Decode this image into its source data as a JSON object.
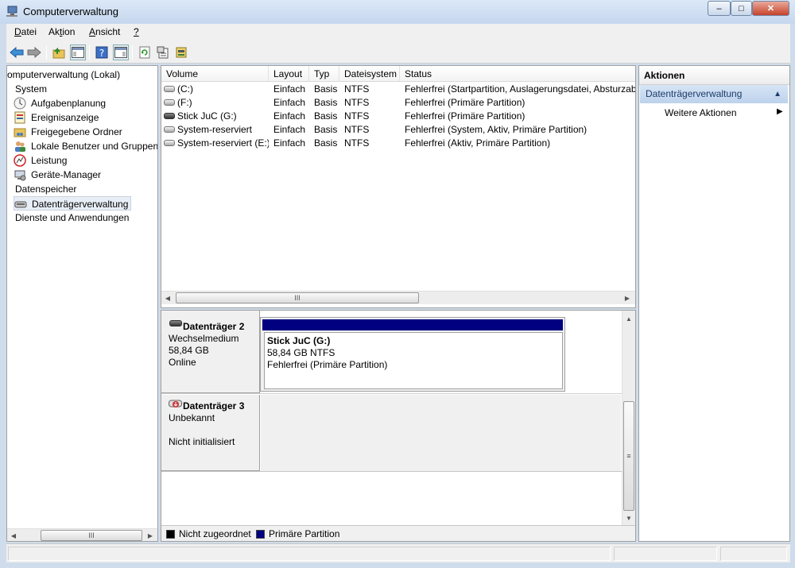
{
  "window": {
    "title": "Computerverwaltung",
    "btn_min": "–",
    "btn_max": "□",
    "btn_close": "✕"
  },
  "menu": {
    "datei": {
      "mnemonic": "D",
      "rest": "atei"
    },
    "aktion": {
      "pre": "Ak",
      "mnemonic": "t",
      "post": "ion"
    },
    "ansicht": {
      "mnemonic": "A",
      "rest": "nsicht"
    },
    "help": "?"
  },
  "tree": {
    "root": "omputerverwaltung (Lokal)",
    "system": "System",
    "items": [
      "Aufgabenplanung",
      "Ereignisanzeige",
      "Freigegebene Ordner",
      "Lokale Benutzer und Gruppen",
      "Leistung",
      "Geräte-Manager"
    ],
    "datenspeicher": "Datenspeicher",
    "selected": "Datenträgerverwaltung",
    "dienste": "Dienste und Anwendungen",
    "scroll_thumb": "III",
    "arrow_left": "◀",
    "arrow_right": "▶"
  },
  "volumes": {
    "headers": [
      "Volume",
      "Layout",
      "Typ",
      "Dateisystem",
      "Status"
    ],
    "rows": [
      {
        "volume": " (C:)",
        "layout": "Einfach",
        "typ": "Basis",
        "fs": "NTFS",
        "status": "Fehlerfrei (Startpartition, Auslagerungsdatei, Absturzab"
      },
      {
        "volume": " (F:)",
        "layout": "Einfach",
        "typ": "Basis",
        "fs": "NTFS",
        "status": "Fehlerfrei (Primäre Partition)"
      },
      {
        "volume": "Stick JuC  (G:)",
        "layout": "Einfach",
        "typ": "Basis",
        "fs": "NTFS",
        "status": "Fehlerfrei (Primäre Partition)"
      },
      {
        "volume": "System-reserviert",
        "layout": "Einfach",
        "typ": "Basis",
        "fs": "NTFS",
        "status": "Fehlerfrei (System, Aktiv, Primäre Partition)"
      },
      {
        "volume": "System-reserviert (E:)",
        "layout": "Einfach",
        "typ": "Basis",
        "fs": "NTFS",
        "status": "Fehlerfrei (Aktiv, Primäre Partition)"
      }
    ],
    "scroll_thumb": "III"
  },
  "disks": {
    "disk2": {
      "name": "Datenträger 2",
      "type": "Wechselmedium",
      "size": "58,84 GB",
      "state": "Online",
      "partition": {
        "name": "Stick JuC  (G:)",
        "size": "58,84 GB NTFS",
        "status": "Fehlerfrei (Primäre Partition)"
      }
    },
    "disk3": {
      "name": "Datenträger 3",
      "type": "Unbekannt",
      "state": "Nicht initialisiert"
    },
    "legend": {
      "unallocated": "Nicht zugeordnet",
      "primary": "Primäre Partition"
    },
    "scroll_thumb": "≡"
  },
  "actions": {
    "header": "Aktionen",
    "section": "Datenträgerverwaltung",
    "more": "Weitere Aktionen"
  },
  "colors": {
    "primary_partition": "#000080",
    "unallocated": "#000000",
    "selection": "#cce4f7"
  }
}
